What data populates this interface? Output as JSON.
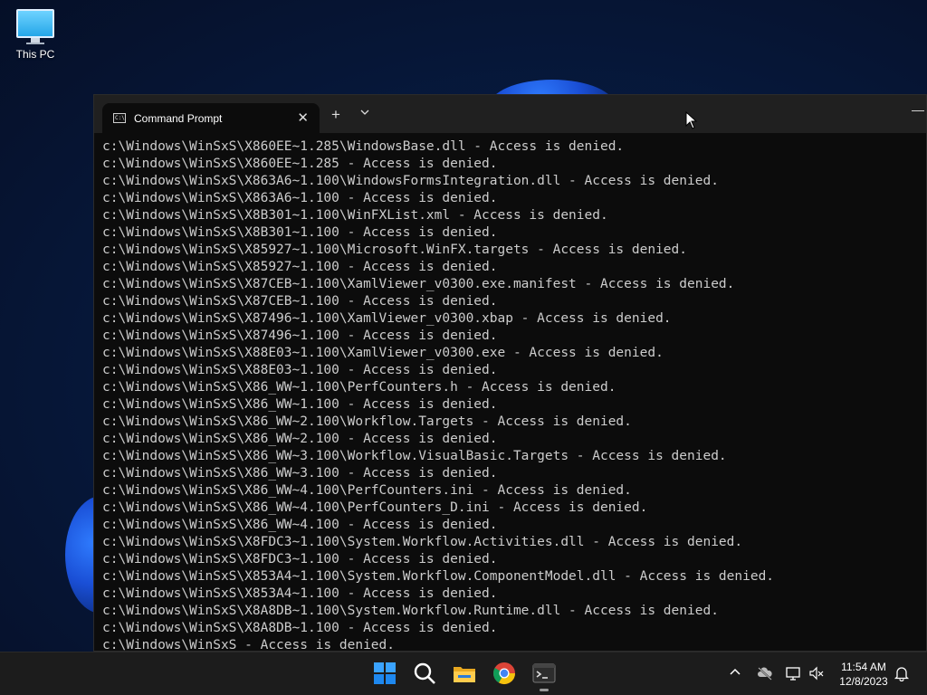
{
  "desktop": {
    "icons": [
      {
        "label": "This PC",
        "icon": "computer-monitor-icon"
      }
    ]
  },
  "window": {
    "tab_title": "Command Prompt",
    "tab_icon": "cmd-icon",
    "tab_icon_text": "C:\\",
    "close_glyph": "✕",
    "new_tab_glyph": "+",
    "dropdown_glyph": "⌄",
    "minimize_glyph": "—"
  },
  "console": {
    "lines": [
      "c:\\Windows\\WinSxS\\X860EE~1.285\\WindowsBase.dll - Access is denied.",
      "c:\\Windows\\WinSxS\\X860EE~1.285 - Access is denied.",
      "c:\\Windows\\WinSxS\\X863A6~1.100\\WindowsFormsIntegration.dll - Access is denied.",
      "c:\\Windows\\WinSxS\\X863A6~1.100 - Access is denied.",
      "c:\\Windows\\WinSxS\\X8B301~1.100\\WinFXList.xml - Access is denied.",
      "c:\\Windows\\WinSxS\\X8B301~1.100 - Access is denied.",
      "c:\\Windows\\WinSxS\\X85927~1.100\\Microsoft.WinFX.targets - Access is denied.",
      "c:\\Windows\\WinSxS\\X85927~1.100 - Access is denied.",
      "c:\\Windows\\WinSxS\\X87CEB~1.100\\XamlViewer_v0300.exe.manifest - Access is denied.",
      "c:\\Windows\\WinSxS\\X87CEB~1.100 - Access is denied.",
      "c:\\Windows\\WinSxS\\X87496~1.100\\XamlViewer_v0300.xbap - Access is denied.",
      "c:\\Windows\\WinSxS\\X87496~1.100 - Access is denied.",
      "c:\\Windows\\WinSxS\\X88E03~1.100\\XamlViewer_v0300.exe - Access is denied.",
      "c:\\Windows\\WinSxS\\X88E03~1.100 - Access is denied.",
      "c:\\Windows\\WinSxS\\X86_WW~1.100\\PerfCounters.h - Access is denied.",
      "c:\\Windows\\WinSxS\\X86_WW~1.100 - Access is denied.",
      "c:\\Windows\\WinSxS\\X86_WW~2.100\\Workflow.Targets - Access is denied.",
      "c:\\Windows\\WinSxS\\X86_WW~2.100 - Access is denied.",
      "c:\\Windows\\WinSxS\\X86_WW~3.100\\Workflow.VisualBasic.Targets - Access is denied.",
      "c:\\Windows\\WinSxS\\X86_WW~3.100 - Access is denied.",
      "c:\\Windows\\WinSxS\\X86_WW~4.100\\PerfCounters.ini - Access is denied.",
      "c:\\Windows\\WinSxS\\X86_WW~4.100\\PerfCounters_D.ini - Access is denied.",
      "c:\\Windows\\WinSxS\\X86_WW~4.100 - Access is denied.",
      "c:\\Windows\\WinSxS\\X8FDC3~1.100\\System.Workflow.Activities.dll - Access is denied.",
      "c:\\Windows\\WinSxS\\X8FDC3~1.100 - Access is denied.",
      "c:\\Windows\\WinSxS\\X853A4~1.100\\System.Workflow.ComponentModel.dll - Access is denied.",
      "c:\\Windows\\WinSxS\\X853A4~1.100 - Access is denied.",
      "c:\\Windows\\WinSxS\\X8A8DB~1.100\\System.Workflow.Runtime.dll - Access is denied.",
      "c:\\Windows\\WinSxS\\X8A8DB~1.100 - Access is denied.",
      "c:\\Windows\\WinSxS - Access is denied."
    ]
  },
  "taskbar": {
    "apps": [
      {
        "name": "start",
        "icon": "windows-start-icon"
      },
      {
        "name": "search",
        "icon": "search-icon"
      },
      {
        "name": "file-explorer",
        "icon": "folder-icon"
      },
      {
        "name": "chrome",
        "icon": "chrome-icon"
      },
      {
        "name": "terminal",
        "icon": "terminal-icon",
        "active": true
      }
    ],
    "tray": {
      "chevron": "^",
      "time": "11:54 AM",
      "date": "12/8/2023"
    }
  },
  "colors": {
    "console_text": "#cccccc",
    "console_bg": "#0c0c0c",
    "titlebar_bg": "#202020",
    "taskbar_bg": "#1c1c1c",
    "accent": "#1e90ff"
  }
}
